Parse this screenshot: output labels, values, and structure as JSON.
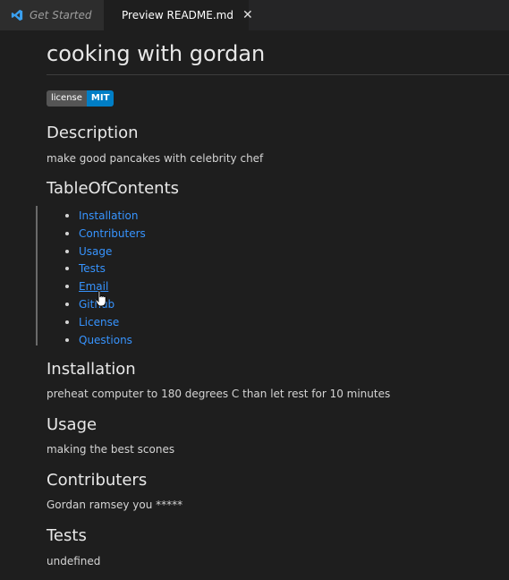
{
  "tabs": [
    {
      "label": "Get Started",
      "active": false
    },
    {
      "label": "Preview README.md",
      "active": true
    }
  ],
  "icons": {
    "vscode": "vscode-logo-icon",
    "preview": "preview-icon",
    "close": "close-icon",
    "cursor": "hand-pointer-cursor-icon"
  },
  "colors": {
    "link": "#3794ff",
    "badge_left": "#555555",
    "badge_right": "#007ec6",
    "background": "#1e1e1e"
  },
  "doc": {
    "title": "cooking with gordan",
    "badge": {
      "label": "license",
      "value": "MIT"
    },
    "description": {
      "heading": "Description",
      "text": "make good pancakes with celebrity chef"
    },
    "toc": {
      "heading": "TableOfContents",
      "items": [
        "Installation",
        "Contributers",
        "Usage",
        "Tests",
        "Email",
        "Github",
        "License",
        "Questions"
      ]
    },
    "installation": {
      "heading": "Installation",
      "text": "preheat computer to 180 degrees C than let rest for 10 minutes"
    },
    "usage": {
      "heading": "Usage",
      "text": "making the best scones"
    },
    "contributers": {
      "heading": "Contributers",
      "text": "Gordan ramsey you *****"
    },
    "tests": {
      "heading": "Tests",
      "text": "undefined"
    }
  }
}
